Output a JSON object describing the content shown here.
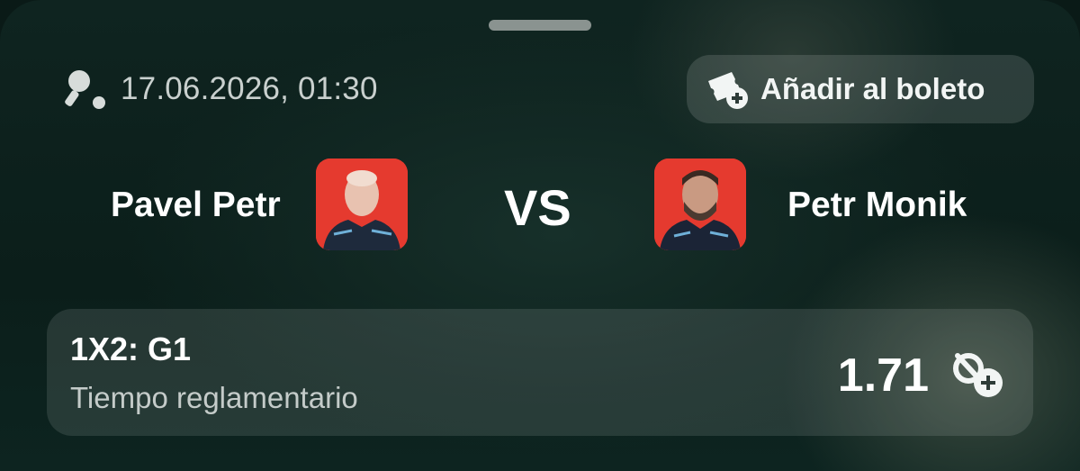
{
  "event": {
    "datetime": "17.06.2026, 01:30",
    "sport_icon": "table-tennis-icon",
    "add_button_label": "Añadir al boleto",
    "add_button_icon": "ticket-add-icon"
  },
  "match": {
    "player1": {
      "name": "Pavel Petr",
      "avatar_bg": "#e53a2f"
    },
    "vs_label": "VS",
    "player2": {
      "name": "Petr Monik",
      "avatar_bg": "#e53a2f"
    }
  },
  "market": {
    "title": "1X2: G1",
    "subtitle": "Tiempo reglamentario",
    "odds": "1.71",
    "odds_icon": "add-to-slip-icon"
  },
  "colors": {
    "background": "#0f2420",
    "accent_text": "#ffffff",
    "muted_text": "#c4cbc9"
  }
}
